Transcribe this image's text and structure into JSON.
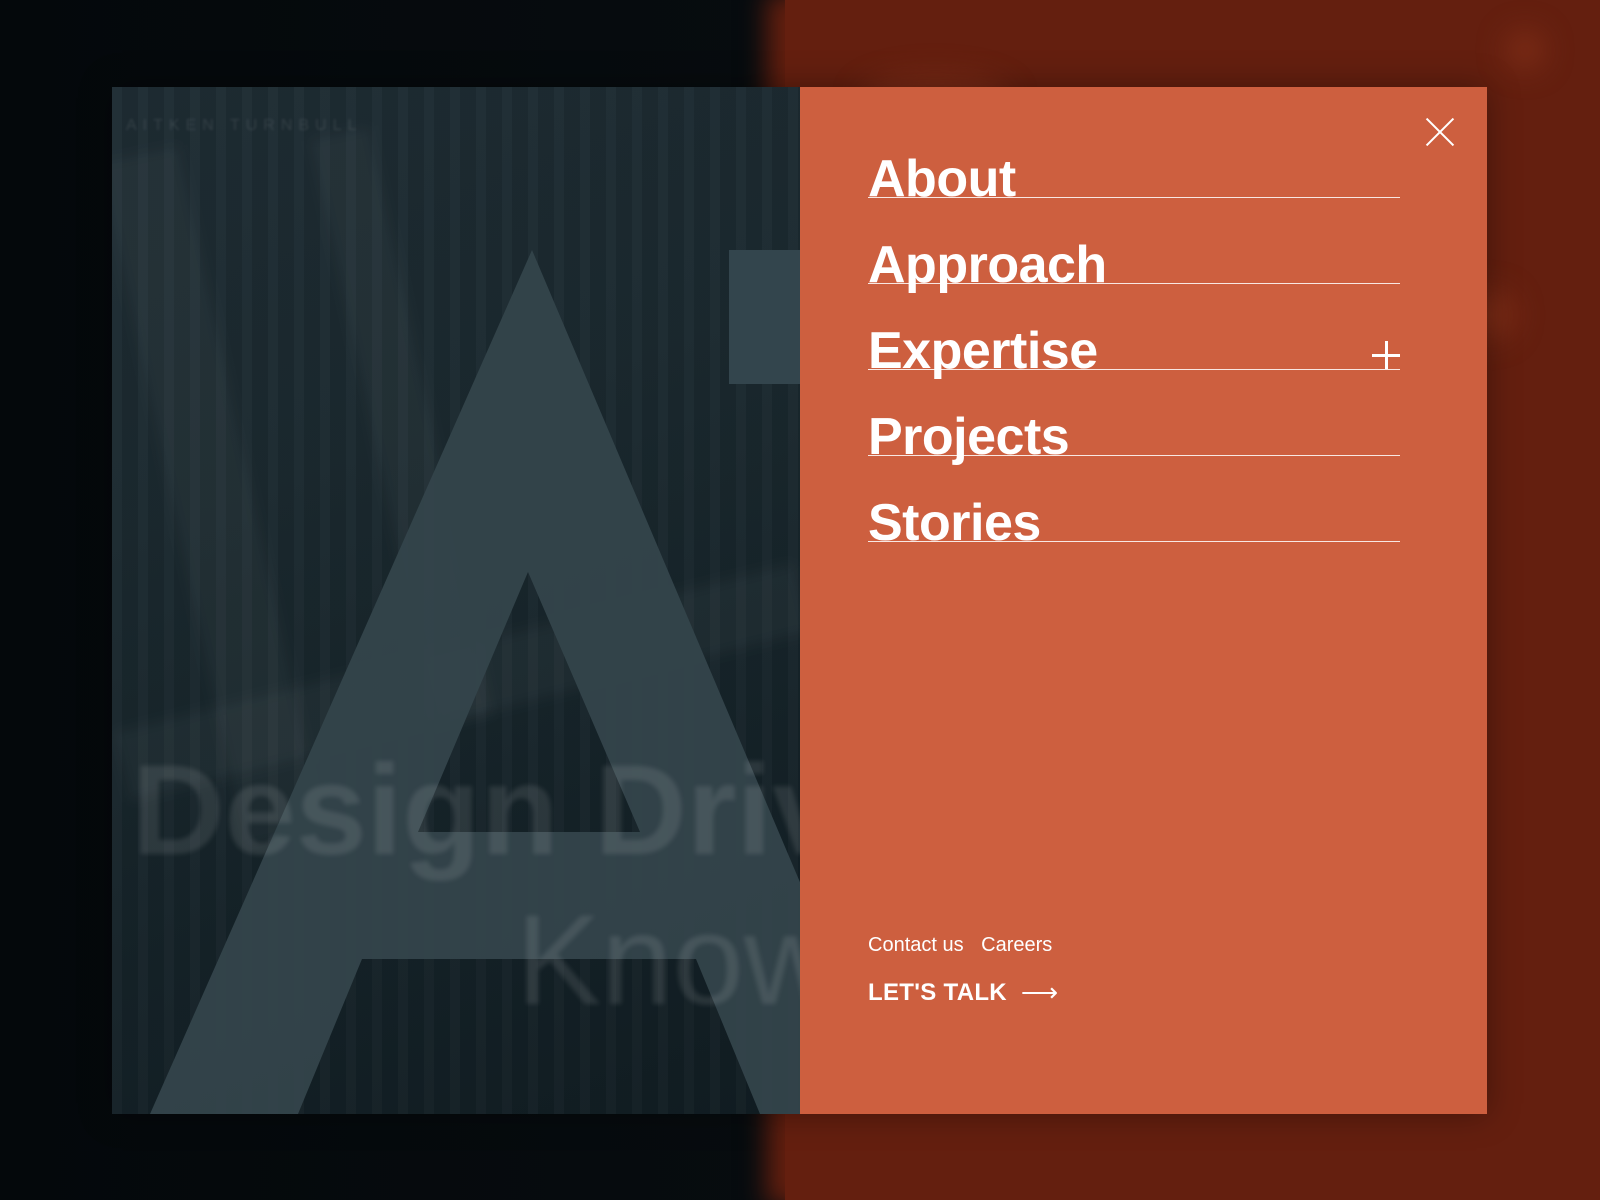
{
  "background": {
    "left_color": "#05090c",
    "right_color": "#641f0f"
  },
  "brand": {
    "name": "AITKEN TURNBULL"
  },
  "hero": {
    "line1": "Design Driv",
    "line2": "Know"
  },
  "menu": {
    "accent_color": "#cd5f3f",
    "close_icon": "close-icon",
    "items": [
      {
        "label": "About"
      },
      {
        "label": "Approach"
      },
      {
        "label": "Expertise",
        "expandable": true,
        "icon": "plus-icon"
      },
      {
        "label": "Projects"
      },
      {
        "label": "Stories"
      }
    ],
    "footer_links": [
      "Contact us",
      "Careers"
    ],
    "cta": {
      "label": "LET'S TALK",
      "icon": "arrow-right-icon"
    }
  }
}
